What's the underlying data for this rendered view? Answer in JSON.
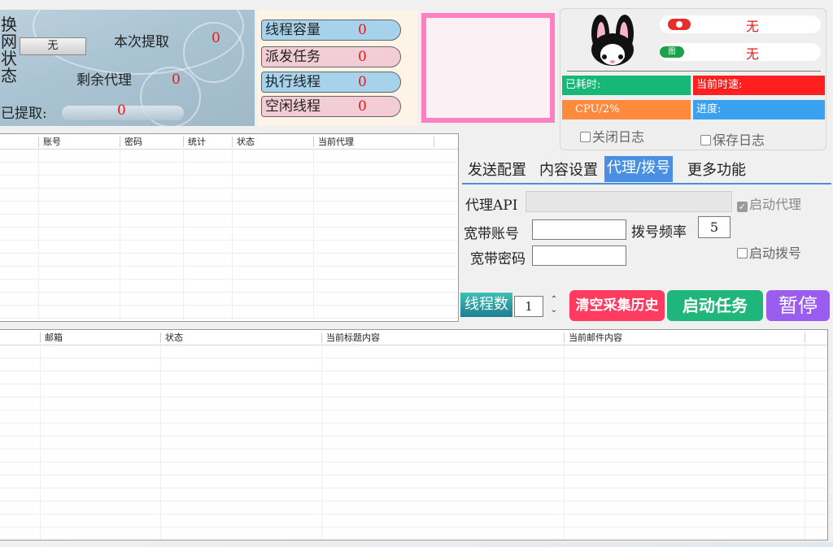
{
  "stat_panel": {
    "switch_chars": [
      "换",
      "网",
      "状",
      "态"
    ],
    "switch_value": "无",
    "this_extract_label": "本次提取",
    "this_extract_value": "0",
    "remain_proxy_label": "剩余代理",
    "remain_proxy_value": "0",
    "extracted_label": "已提取:",
    "extracted_value": "0"
  },
  "threads": {
    "capacity": {
      "label": "线程容量",
      "value": "0"
    },
    "dispatched": {
      "label": "派发任务",
      "value": "0"
    },
    "running": {
      "label": "执行线程",
      "value": "0"
    },
    "idle": {
      "label": "空闲线程",
      "value": "0"
    }
  },
  "info": {
    "status1_value": "无",
    "status2_icon_text": "图",
    "status2_value": "无",
    "elapsed_label": "已耗时:",
    "speed_label": "当前时速:",
    "cpu_label": "CPU/2%",
    "progress_label": "进度:",
    "close_log_label": "关闭日志",
    "save_log_label": "保存日志"
  },
  "account_table": {
    "columns": [
      "账号",
      "密码",
      "统计",
      "状态",
      "当前代理"
    ]
  },
  "tabs": [
    "发送配置",
    "内容设置",
    "代理/拨号",
    "更多功能"
  ],
  "proxy_config": {
    "api_label": "代理API",
    "api_value": "",
    "enable_proxy_label": "启动代理",
    "broadband_account_label": "宽带账号",
    "broadband_account_value": "",
    "dial_freq_label": "拨号频率",
    "dial_freq_value": "5",
    "broadband_password_label": "宽带密码",
    "broadband_password_value": "",
    "enable_dial_label": "启动拨号"
  },
  "controls": {
    "thread_count_label": "线程数",
    "thread_count_value": "1",
    "clear_history_label": "清空采集历史",
    "start_label": "启动任务",
    "pause_label": "暂停"
  },
  "mail_table": {
    "columns": [
      "邮箱",
      "状态",
      "当前标题内容",
      "当前邮件内容"
    ]
  },
  "colors": {
    "elapsed": "#17b877",
    "speed": "#ff1f1f",
    "cpu": "#ff8a3d",
    "progress": "#3aa0f0",
    "start_btn": "#1eb67a",
    "clear_btn": "#ff3b60",
    "pause_btn": "#9b5cf0"
  }
}
